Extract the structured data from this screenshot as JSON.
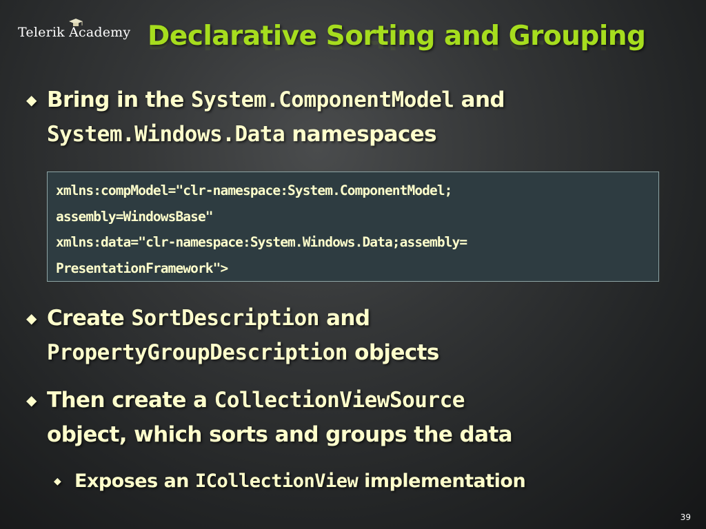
{
  "header": {
    "logo_text": "Telerik Academy",
    "title": "Declarative Sorting and Grouping"
  },
  "bullets": [
    {
      "line1_pre": "Bring in the ",
      "line1_code": "System.ComponentModel",
      "line1_post": " and",
      "line2_code": "System.Windows.Data",
      "line2_post": " namespaces"
    },
    {
      "line1_pre": "Create ",
      "line1_code": "SortDescription",
      "line1_post": " and",
      "line2_code": "PropertyGroupDescription",
      "line2_post": " objects"
    },
    {
      "line1_pre": "Then create a ",
      "line1_code": "CollectionViewSource",
      "line2_text": "object, which sorts and groups the data"
    }
  ],
  "sub_bullet": {
    "pre": "Exposes an ",
    "code": "ICollectionView",
    "post": " implementation"
  },
  "code_block": {
    "lines": [
      "xmlns:compModel=\"clr-namespace:System.ComponentModel;",
      "assembly=WindowsBase\"",
      "xmlns:data=\"clr-namespace:System.Windows.Data;assembly=",
      "PresentationFramework\">"
    ]
  },
  "footer": {
    "page_number": "39"
  },
  "colors": {
    "title": "#a6dd1e",
    "body_text": "#ffffcc",
    "code_box_bg": "#2e3c41",
    "code_box_border": "#8fa6a6"
  },
  "icons": {
    "bullet": "diamond-icon",
    "logo": "graduation-cap-icon"
  }
}
